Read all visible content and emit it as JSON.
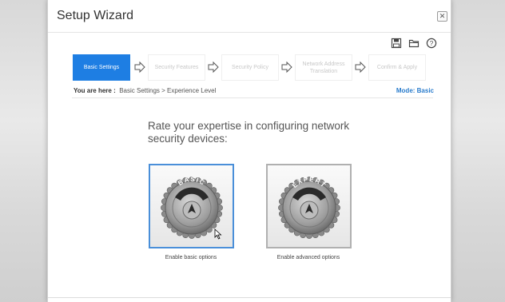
{
  "window": {
    "title": "Setup Wizard",
    "close_icon": "close-icon"
  },
  "toolbar": {
    "icons": [
      "save-icon",
      "folder-icon",
      "help-icon"
    ]
  },
  "steps": [
    {
      "label": "Basic Settings",
      "active": true
    },
    {
      "label": "Security Features",
      "active": false
    },
    {
      "label": "Security Policy",
      "active": false
    },
    {
      "label": "Network Address Translation",
      "active": false
    },
    {
      "label": "Confirm & Apply",
      "active": false
    }
  ],
  "breadcrumb": {
    "lead": "You are here :",
    "path": "Basic Settings > Experience Level"
  },
  "mode": "Mode: Basic",
  "prompt": "Rate your expertise in configuring network security devices:",
  "options": {
    "basic": {
      "knob_label": "BASIC",
      "caption": "Enable basic options",
      "selected": true
    },
    "expert": {
      "knob_label": "EXPERT",
      "caption": "Enable advanced options",
      "selected": false
    }
  },
  "colors": {
    "accent": "#1e7ee3",
    "selection_border": "#4a8fd9",
    "mode_text": "#2a7ccc"
  }
}
